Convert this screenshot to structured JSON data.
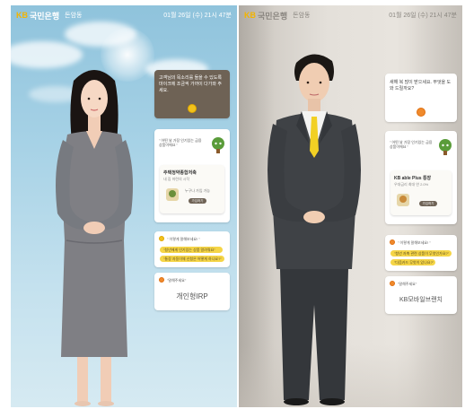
{
  "left": {
    "brand": {
      "mark": "KB",
      "name": "국민은행",
      "branch": "돈암동"
    },
    "datetime": "01월 26일 (수) 21시 47분",
    "greeting_card": {
      "text": "고객님의 목소리를 들을 수 있도록 마이크에 조금씩 가까이 다가와 주세요."
    },
    "recommend_card": {
      "prompt": "\" 어떤 날 가장 인기있는 금융 상품이에요 \"",
      "product_title": "주택청약종합저축",
      "product_sub": "내 집 마련의 시작",
      "product_detail": "누구나 가입 가능",
      "product_button": "가입하기"
    },
    "suggest_card": {
      "prompt": "\" 이렇게 말해보세요! \"",
      "pill1": "\"청년에게 인기있는 상품 알려줘요\"",
      "pill2": "\"통장 자동이체 신청은 어떻게 하나요?\""
    },
    "speak_card": {
      "prompt": "\"말해주세요\"",
      "answer": "개인형IRP"
    }
  },
  "right": {
    "brand": {
      "mark": "KB",
      "name": "국민은행",
      "branch": "돈암동"
    },
    "datetime": "01월 26일 (수) 21시 47분",
    "greeting_card": {
      "text": "새해 복 많이 받으세요. 무엇을 도와 드릴까요?"
    },
    "recommend_card": {
      "prompt": "\" 어떤 날 가장 인기있는 금융 상품이에요 \"",
      "product_title": "KB able Plus 통장",
      "product_sub": "우대금리 최대 연 2.0%",
      "product_button": "가입하기"
    },
    "suggest_card": {
      "prompt": "\" 이렇게 말해보세요! \"",
      "pill1": "\"청년 저축 관련 상품이 무엇인가요?\"",
      "pill2": "\"다음카드 무엇이 있나요?\""
    },
    "speak_card": {
      "prompt": "\"말해주세요\"",
      "answer": "KB모바일브랜치"
    }
  },
  "colors": {
    "kb_yellow": "#f3b400",
    "sky_top": "#8fc3dc",
    "studio_bg": "#e4e0da",
    "dark_card": "#6e6255",
    "tie": "#f2d024"
  }
}
